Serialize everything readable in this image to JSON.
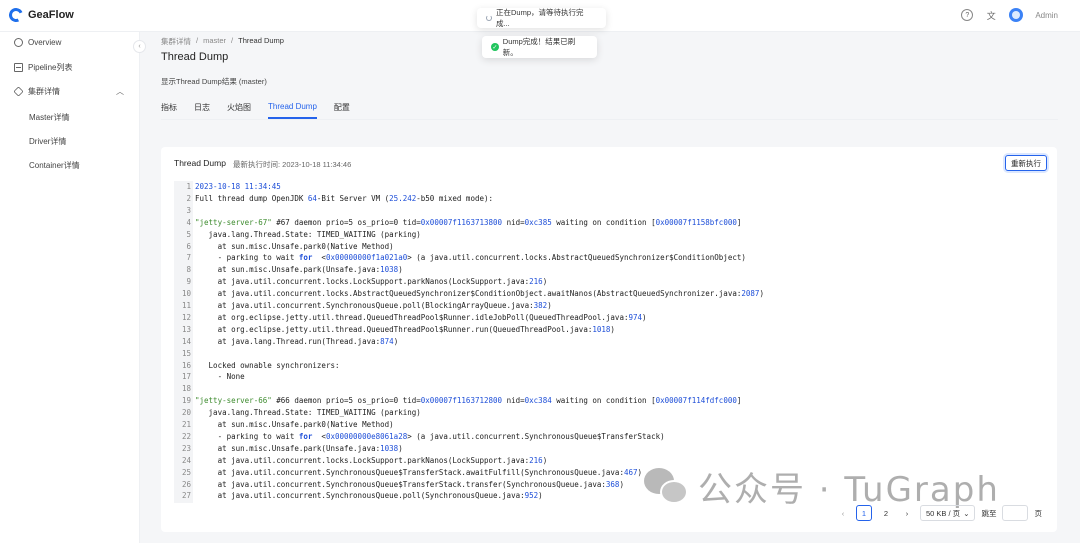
{
  "app": {
    "name": "GeaFlow",
    "user": "Admin"
  },
  "header_icons": [
    "help-icon",
    "translate-icon"
  ],
  "sidebar": {
    "items": [
      {
        "label": "Overview",
        "icon": "overview-icon"
      },
      {
        "label": "Pipeline列表",
        "icon": "table-icon"
      },
      {
        "label": "集群详情",
        "icon": "cluster-icon"
      }
    ],
    "sub_items": [
      "Master详情",
      "Driver详情",
      "Container详情"
    ]
  },
  "breadcrumb": [
    "集群详情",
    "/",
    "master",
    "/",
    "Thread Dump"
  ],
  "page": {
    "title": "Thread Dump",
    "description": "显示Thread Dump结果 (master)"
  },
  "tabs": [
    {
      "label": "指标",
      "active": false
    },
    {
      "label": "日志",
      "active": false
    },
    {
      "label": "火焰图",
      "active": false
    },
    {
      "label": "Thread Dump",
      "active": true
    },
    {
      "label": "配置",
      "active": false
    }
  ],
  "toasts": {
    "running": "正在Dump，请等待执行完成...",
    "done": "Dump完成！结果已刷新。"
  },
  "card": {
    "title": "Thread Dump",
    "meta": "最新执行时间: 2023-10-18 11:34:46",
    "rerun_label": "重新执行"
  },
  "code_lines": [
    "<span class=\"num\">2023-10-18 11:34:45</span>",
    "Full thread dump OpenJDK <span class=\"num\">64</span>-Bit Server VM (<span class=\"num\">25.242</span>-b50 mixed mode):",
    "",
    "<span class=\"str\">\"jetty-server-67\"</span> #67 daemon prio=5 os_prio=0 tid=<span class=\"num\">0x00007f1163713800</span> nid=<span class=\"num\">0xc385</span> waiting on condition [<span class=\"num\">0x00007f1158bfc000</span>]",
    "   java.lang.Thread.State: TIMED_WAITING (parking)",
    "     at sun.misc.Unsafe.park0(Native Method)",
    "     - parking to wait <span class=\"kw\">for</span>  &lt;<span class=\"num\">0x00000000f1a021a0</span>&gt; (a java.util.concurrent.locks.AbstractQueuedSynchronizer$ConditionObject)",
    "     at sun.misc.Unsafe.park(Unsafe.java:<span class=\"num\">1038</span>)",
    "     at java.util.concurrent.locks.LockSupport.parkNanos(LockSupport.java:<span class=\"num\">216</span>)",
    "     at java.util.concurrent.locks.AbstractQueuedSynchronizer$ConditionObject.awaitNanos(AbstractQueuedSynchronizer.java:<span class=\"num\">2087</span>)",
    "     at java.util.concurrent.SynchronousQueue.poll(BlockingArrayQueue.java:<span class=\"num\">382</span>)",
    "     at org.eclipse.jetty.util.thread.QueuedThreadPool$Runner.idleJobPoll(QueuedThreadPool.java:<span class=\"num\">974</span>)",
    "     at org.eclipse.jetty.util.thread.QueuedThreadPool$Runner.run(QueuedThreadPool.java:<span class=\"num\">1018</span>)",
    "     at java.lang.Thread.run(Thread.java:<span class=\"num\">874</span>)",
    "",
    "   Locked ownable synchronizers:",
    "     - None",
    "",
    "<span class=\"str\">\"jetty-server-66\"</span> #66 daemon prio=5 os_prio=0 tid=<span class=\"num\">0x00007f1163712800</span> nid=<span class=\"num\">0xc384</span> waiting on condition [<span class=\"num\">0x00007f114fdfc000</span>]",
    "   java.lang.Thread.State: TIMED_WAITING (parking)",
    "     at sun.misc.Unsafe.park0(Native Method)",
    "     - parking to wait <span class=\"kw\">for</span>  &lt;<span class=\"num\">0x00000000e8061a28</span>&gt; (a java.util.concurrent.SynchronousQueue$TransferStack)",
    "     at sun.misc.Unsafe.park(Unsafe.java:<span class=\"num\">1038</span>)",
    "     at java.util.concurrent.locks.LockSupport.parkNanos(LockSupport.java:<span class=\"num\">216</span>)",
    "     at java.util.concurrent.SynchronousQueue$TransferStack.awaitFulfill(SynchronousQueue.java:<span class=\"num\">467</span>)",
    "     at java.util.concurrent.SynchronousQueue$TransferStack.transfer(SynchronousQueue.java:<span class=\"num\">368</span>)",
    "     at java.util.concurrent.SynchronousQueue.poll(SynchronousQueue.java:<span class=\"num\">952</span>)"
  ],
  "pagination": {
    "pages": [
      "1",
      "2"
    ],
    "current": "1",
    "page_size": "50 KB / 页",
    "goto_label": "跳至",
    "goto_suffix": "页"
  },
  "watermark": "公众号 · TuGraph",
  "colors": {
    "accent": "#2563eb",
    "success": "#22c55e",
    "string": "#3d8b2e",
    "number": "#1d4ed8"
  }
}
